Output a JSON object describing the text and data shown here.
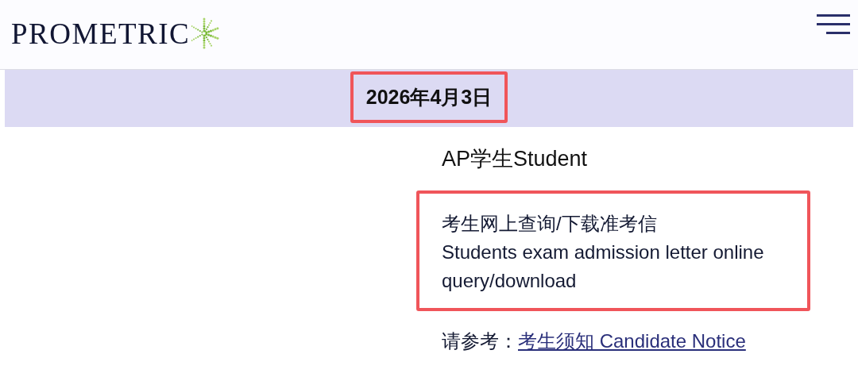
{
  "header": {
    "logo": "PROMETRIC"
  },
  "date_banner": {
    "text": "2026年4月3日",
    "highlighted": true
  },
  "section": {
    "title": "AP学生Student",
    "notice": {
      "lines": [
        "考生网上查询/下载准考信",
        "Students exam admission letter online query/download"
      ],
      "highlighted": true
    },
    "reference": {
      "label": "请参考：",
      "link": "考生须知 Candidate Notice"
    }
  }
}
